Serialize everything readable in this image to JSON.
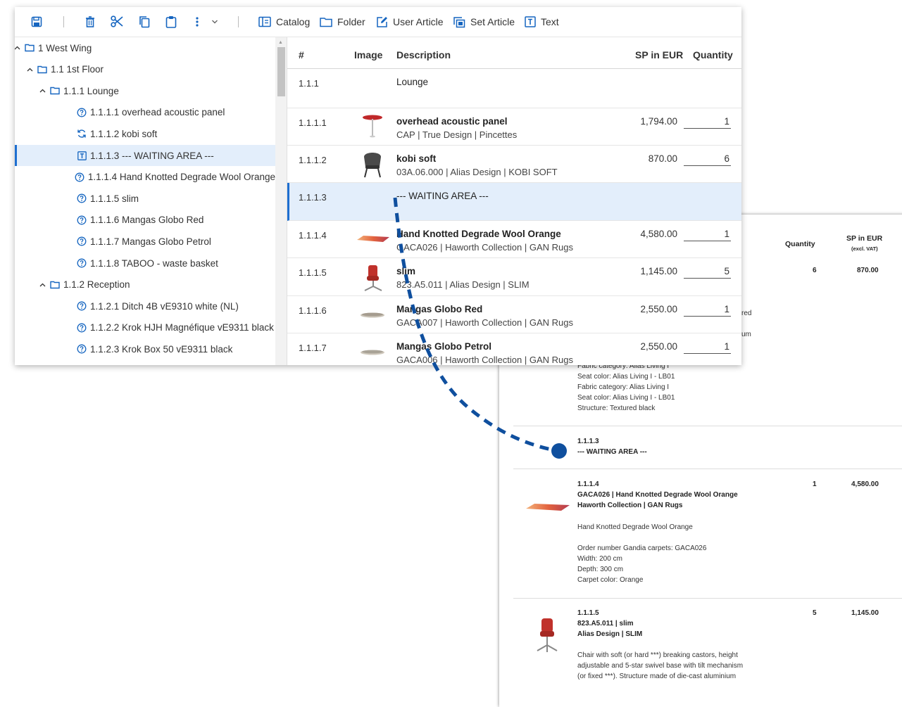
{
  "toolbar": {
    "catalog": "Catalog",
    "folder": "Folder",
    "user_article": "User Article",
    "set_article": "Set Article",
    "text": "Text"
  },
  "tree": [
    {
      "label": "1 West Wing",
      "icon": "folder-icon"
    },
    {
      "label": "1.1 1st Floor",
      "icon": "folder-icon"
    },
    {
      "label": "1.1.1 Lounge",
      "icon": "folder-icon"
    },
    {
      "label": "1.1.1.1 overhead acoustic panel",
      "icon": "help-circle-icon"
    },
    {
      "label": "1.1.1.2 kobi soft",
      "icon": "sync-icon"
    },
    {
      "label": "1.1.1.3 --- WAITING AREA ---",
      "icon": "text-box-icon"
    },
    {
      "label": "1.1.1.4 Hand Knotted Degrade Wool Orange",
      "icon": "help-circle-icon"
    },
    {
      "label": "1.1.1.5 slim",
      "icon": "help-circle-icon"
    },
    {
      "label": "1.1.1.6 Mangas Globo Red",
      "icon": "help-circle-icon"
    },
    {
      "label": "1.1.1.7 Mangas Globo Petrol",
      "icon": "help-circle-icon"
    },
    {
      "label": "1.1.1.8 TABOO - waste basket",
      "icon": "help-circle-icon"
    },
    {
      "label": "1.1.2 Reception",
      "icon": "folder-icon"
    },
    {
      "label": "1.1.2.1 Ditch 4B vE9310 white (NL)",
      "icon": "help-circle-icon"
    },
    {
      "label": "1.1.2.2 Krok HJH Magnéfique vE9311 black",
      "icon": "help-circle-icon"
    },
    {
      "label": "1.1.2.3 Krok Box 50 vE9311 black",
      "icon": "help-circle-icon"
    }
  ],
  "table": {
    "headers": {
      "num": "#",
      "image": "Image",
      "description": "Description",
      "price": "SP in EUR",
      "quantity": "Quantity"
    },
    "rows": [
      {
        "num": "1.1.1",
        "title": "Lounge",
        "sub": "",
        "price": "",
        "qty": ""
      },
      {
        "num": "1.1.1.1",
        "title": "overhead acoustic panel",
        "sub": "CAP | True Design | Pincettes",
        "price": "1,794.00",
        "qty": "1"
      },
      {
        "num": "1.1.1.2",
        "title": "kobi soft",
        "sub": "03A.06.000 | Alias Design | KOBI SOFT",
        "price": "870.00",
        "qty": "6"
      },
      {
        "num": "1.1.1.3",
        "title": "--- WAITING AREA ---",
        "sub": "",
        "price": "",
        "qty": ""
      },
      {
        "num": "1.1.1.4",
        "title": "Hand Knotted Degrade Wool Orange",
        "sub": "GACA026 | Haworth Collection | GAN Rugs",
        "price": "4,580.00",
        "qty": "1"
      },
      {
        "num": "1.1.1.5",
        "title": "slim",
        "sub": "823.A5.011 | Alias Design | SLIM",
        "price": "1,145.00",
        "qty": "5"
      },
      {
        "num": "1.1.1.6",
        "title": "Mangas Globo Red",
        "sub": "GACA007 | Haworth Collection | GAN Rugs",
        "price": "2,550.00",
        "qty": "1"
      },
      {
        "num": "1.1.1.7",
        "title": "Mangas Globo Petrol",
        "sub": "GACA006 | Haworth Collection | GAN Rugs",
        "price": "2,550.00",
        "qty": "1"
      }
    ]
  },
  "document": {
    "header_quantity": "Quantity",
    "header_price": "SP in EUR",
    "header_price_sub": "(excl. VAT)",
    "row1_qty": "6",
    "row1_price": "870.00",
    "frag_red": "red",
    "frag_um": "um",
    "upper_lines": [
      "Fabric category: Alias Living I",
      "Seat color: Alias Living I - LB01",
      "Fabric category: Alias Living I",
      "Seat color: Alias Living I - LB01",
      "Structure: Textured black"
    ],
    "waiting_num": "1.1.1.3",
    "waiting_title": "--- WAITING AREA ---",
    "rug_num": "1.1.1.4",
    "rug_line1": "GACA026 | Hand Knotted Degrade Wool Orange",
    "rug_line2": "Haworth Collection | GAN Rugs",
    "rug_desc": "Hand Knotted Degrade Wool Orange",
    "rug_lines": [
      "Order number Gandia carpets: GACA026",
      "Width: 200 cm",
      "Depth: 300 cm",
      "Carpet color: Orange"
    ],
    "rug_qty": "1",
    "rug_price": "4,580.00",
    "slim_num": "1.1.1.5",
    "slim_line1": "823.A5.011 | slim",
    "slim_line2": "Alias Design | SLIM",
    "slim_desc1": "Chair with soft (or hard ***) breaking castors, height",
    "slim_desc2": "adjustable and 5-star swivel base with tilt mechanism",
    "slim_desc3": "(or fixed ***). Structure made of die-cast aluminium",
    "slim_qty": "5",
    "slim_price": "1,145.00"
  },
  "colors": {
    "accent": "#1e6fd0",
    "selection": "#e3eefb",
    "connector": "#0f4f9e"
  }
}
